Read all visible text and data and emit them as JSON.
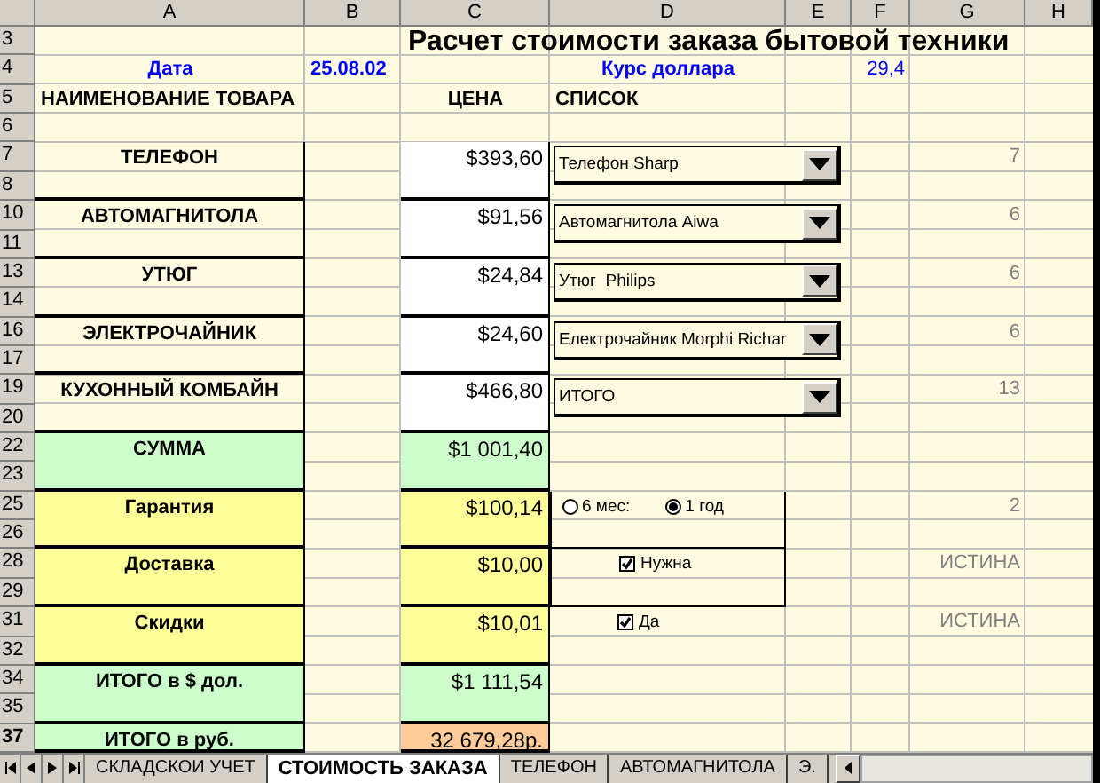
{
  "columns": [
    "A",
    "B",
    "C",
    "D",
    "E",
    "F",
    "G",
    "H"
  ],
  "rows": [
    {
      "label": "3",
      "selected": false
    },
    {
      "label": "4",
      "selected": false
    },
    {
      "label": "5",
      "selected": false
    },
    {
      "label": "6",
      "selected": false
    },
    {
      "label": "7",
      "selected": false
    },
    {
      "label": "8",
      "selected": false
    },
    {
      "label": "10",
      "selected": false
    },
    {
      "label": "11",
      "selected": false
    },
    {
      "label": "13",
      "selected": false
    },
    {
      "label": "14",
      "selected": false
    },
    {
      "label": "16",
      "selected": false
    },
    {
      "label": "17",
      "selected": false
    },
    {
      "label": "19",
      "selected": false
    },
    {
      "label": "20",
      "selected": false
    },
    {
      "label": "22",
      "selected": false
    },
    {
      "label": "23",
      "selected": false
    },
    {
      "label": "25",
      "selected": false
    },
    {
      "label": "26",
      "selected": false
    },
    {
      "label": "28",
      "selected": false
    },
    {
      "label": "29",
      "selected": false
    },
    {
      "label": "31",
      "selected": false
    },
    {
      "label": "32",
      "selected": false
    },
    {
      "label": "34",
      "selected": false
    },
    {
      "label": "35",
      "selected": false
    },
    {
      "label": "37",
      "selected": true
    }
  ],
  "title": "Расчет стоимости заказа бытовой техники",
  "date": {
    "label": "Дата",
    "value": "25.08.02"
  },
  "rate": {
    "label": "Курс доллара",
    "value": "29,4"
  },
  "headers": {
    "name": "НАИМЕНОВАНИЕ ТОВАРА",
    "price": "ЦЕНА",
    "list": "СПИСОК"
  },
  "items": [
    {
      "name": "ТЕЛЕФОН",
      "price": "$393,60",
      "choice": "Телефон Sharp",
      "count": "7"
    },
    {
      "name": "АВТОМАГНИТОЛА",
      "price": "$91,56",
      "choice": "Автомагнитола Aiwa",
      "count": "6"
    },
    {
      "name": "УТЮГ",
      "price": "$24,84",
      "choice": "Утюг  Philips",
      "count": "6"
    },
    {
      "name": "ЭЛЕКТРОЧАЙНИК",
      "price": "$24,60",
      "choice": "Електрочайник Morphi Richar",
      "count": "6"
    },
    {
      "name": "КУХОННЫЙ КОМБАЙН",
      "price": "$466,80",
      "choice": "ИТОГО",
      "count": "13"
    }
  ],
  "summary": [
    {
      "kind": "total",
      "label": "СУММА",
      "value": "$1 001,40"
    },
    {
      "kind": "option",
      "label": "Гарантия",
      "value": "$100,14",
      "control": {
        "kind": "radio",
        "framed": true,
        "options": [
          {
            "label": "6 мес:",
            "selected": false
          },
          {
            "label": "1 год",
            "selected": true
          }
        ]
      },
      "result": "2"
    },
    {
      "kind": "option",
      "label": "Доставка",
      "value": "$10,00",
      "control": {
        "kind": "checkbox",
        "framed": true,
        "label": "Нужна",
        "checked": true
      },
      "result": "ИСТИНА"
    },
    {
      "kind": "option",
      "label": "Скидки",
      "value": "$10,01",
      "control": {
        "kind": "checkbox",
        "framed": false,
        "label": "Да",
        "checked": true
      },
      "result": "ИСТИНА"
    },
    {
      "kind": "total",
      "label": "ИТОГО в $ дол.",
      "value": "$1 111,54"
    }
  ],
  "grand_total": {
    "label": "ИТОГО в  руб.",
    "value": "32 679,28р."
  },
  "sheet_tabs": [
    {
      "label": "СКЛАДСКОИ УЧЕТ",
      "selected": false
    },
    {
      "label": "СТОИМОСТЬ ЗАКАЗА",
      "selected": true
    },
    {
      "label": "ТЕЛЕФОН",
      "selected": false
    },
    {
      "label": "АВТОМАГНИТОЛА",
      "selected": false
    },
    {
      "label": "Э.",
      "selected": false
    }
  ]
}
